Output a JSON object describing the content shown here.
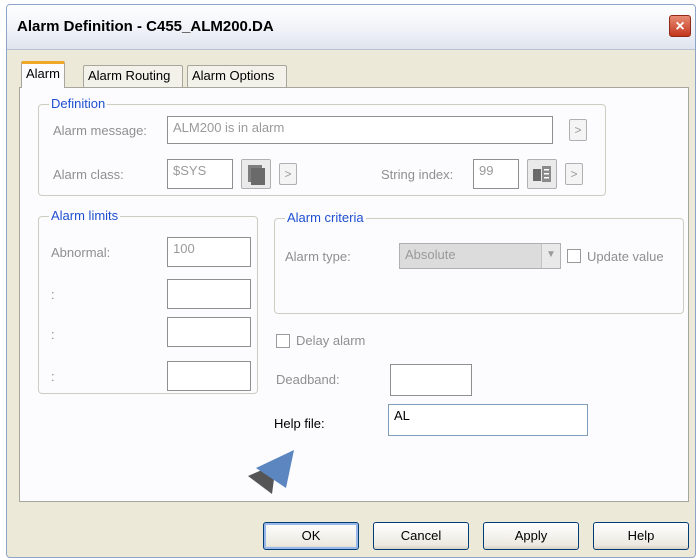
{
  "window": {
    "title": "Alarm Definition - C455_ALM200.DA",
    "close_icon": "×"
  },
  "tabs": [
    {
      "label": "Alarm",
      "active": true
    },
    {
      "label": "Alarm Routing",
      "active": false
    },
    {
      "label": "Alarm Options",
      "active": false
    }
  ],
  "definition": {
    "legend": "Definition",
    "message_label": "Alarm message:",
    "message_value": "ALM200 is in alarm",
    "class_label": "Alarm class:",
    "class_value": "$SYS",
    "string_index_label": "String index:",
    "string_index_value": "99",
    "arrow": ">"
  },
  "limits": {
    "legend": "Alarm limits",
    "abnormal_label": "Abnormal:",
    "abnormal_value": "100",
    "row2_label": ":",
    "row3_label": ":",
    "row4_label": ":"
  },
  "criteria": {
    "legend": "Alarm criteria",
    "type_label": "Alarm type:",
    "type_value": "Absolute",
    "update_label": "Update value"
  },
  "options": {
    "delay_label": "Delay alarm",
    "deadband_label": "Deadband:",
    "deadband_value": "",
    "help_label": "Help file:",
    "help_value": "AL"
  },
  "buttons": {
    "ok": "OK",
    "cancel": "Cancel",
    "apply": "Apply",
    "help": "Help"
  }
}
